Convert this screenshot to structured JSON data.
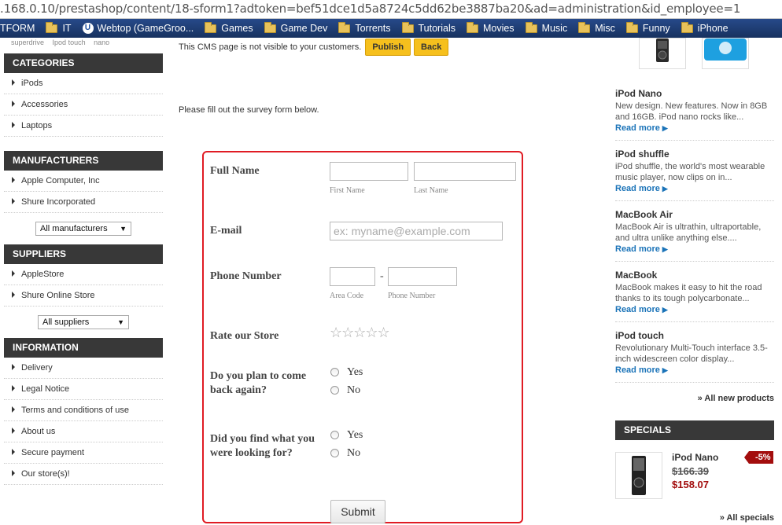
{
  "browser": {
    "url": ".168.0.10/prestashop/content/18-sform1?adtoken=bef51dce1d5a8724c5dd62be3887ba20&ad=administration&id_employee=1",
    "bookmarks": [
      {
        "label": "TFORM",
        "icon": "none"
      },
      {
        "label": "IT",
        "icon": "folder-icon"
      },
      {
        "label": "Webtop (GameGroo...",
        "icon": "webtop-icon"
      },
      {
        "label": "Games",
        "icon": "folder-icon"
      },
      {
        "label": "Game Dev",
        "icon": "folder-icon"
      },
      {
        "label": "Torrents",
        "icon": "folder-icon"
      },
      {
        "label": "Tutorials",
        "icon": "folder-icon"
      },
      {
        "label": "Movies",
        "icon": "folder-icon"
      },
      {
        "label": "Music",
        "icon": "folder-icon"
      },
      {
        "label": "Misc",
        "icon": "folder-icon"
      },
      {
        "label": "Funny",
        "icon": "folder-icon"
      },
      {
        "label": "iPhone",
        "icon": "folder-icon"
      }
    ]
  },
  "left": {
    "top_links": [
      "superdrive",
      "Ipod touch",
      "nano"
    ],
    "categories": {
      "title": "CATEGORIES",
      "items": [
        "iPods",
        "Accessories",
        "Laptops"
      ]
    },
    "manufacturers": {
      "title": "MANUFACTURERS",
      "items": [
        "Apple Computer, Inc",
        "Shure Incorporated"
      ],
      "select": "All manufacturers"
    },
    "suppliers": {
      "title": "SUPPLIERS",
      "items": [
        "AppleStore",
        "Shure Online Store"
      ],
      "select": "All suppliers"
    },
    "information": {
      "title": "INFORMATION",
      "items": [
        "Delivery",
        "Legal Notice",
        "Terms and conditions of use",
        "About us",
        "Secure payment",
        "Our store(s)!"
      ]
    }
  },
  "cms": {
    "notice": "This CMS page is not visible to your customers.",
    "publish": "Publish",
    "back": "Back",
    "intro": "Please fill out the survey form below."
  },
  "form": {
    "full_name": "Full Name",
    "first_name": "First Name",
    "last_name": "Last Name",
    "email": "E-mail",
    "email_placeholder": "ex: myname@example.com",
    "phone": "Phone Number",
    "phone_dash": "-",
    "area_code": "Area Code",
    "phone_number_sub": "Phone Number",
    "rate": "Rate our Store",
    "rating_stars": "☆☆☆☆☆",
    "rating_value": 0,
    "come_back_q": "Do you plan to come back again?",
    "find_q": "Did you find what you were looking for?",
    "yes": "Yes",
    "no": "No",
    "submit": "Submit"
  },
  "right": {
    "products": [
      {
        "name": "iPod Nano",
        "desc": "New design. New features. Now in 8GB and 16GB. iPod nano rocks like...",
        "more": "Read more"
      },
      {
        "name": "iPod shuffle",
        "desc": "iPod shuffle, the world's most wearable music player, now clips on in...",
        "more": "Read more"
      },
      {
        "name": "MacBook Air",
        "desc": "MacBook Air is ultrathin, ultraportable, and ultra unlike anything else....",
        "more": "Read more"
      },
      {
        "name": "MacBook",
        "desc": "MacBook makes it easy to hit the road thanks to its tough polycarbonate...",
        "more": "Read more"
      },
      {
        "name": "iPod touch",
        "desc": "Revolutionary Multi-Touch interface 3.5-inch widescreen color display...",
        "more": "Read more"
      }
    ],
    "all_new": "» All new products",
    "specials_title": "SPECIALS",
    "special": {
      "name": "iPod Nano",
      "old_price": "$166.39",
      "new_price": "$158.07",
      "discount": "-5%"
    },
    "all_specials": "» All specials"
  },
  "colors": {
    "accent_red": "#e01c24",
    "button_yellow": "#f6c01d",
    "link_blue": "#1a73b8",
    "price_red": "#a30d0d",
    "block_dark": "#383838"
  }
}
